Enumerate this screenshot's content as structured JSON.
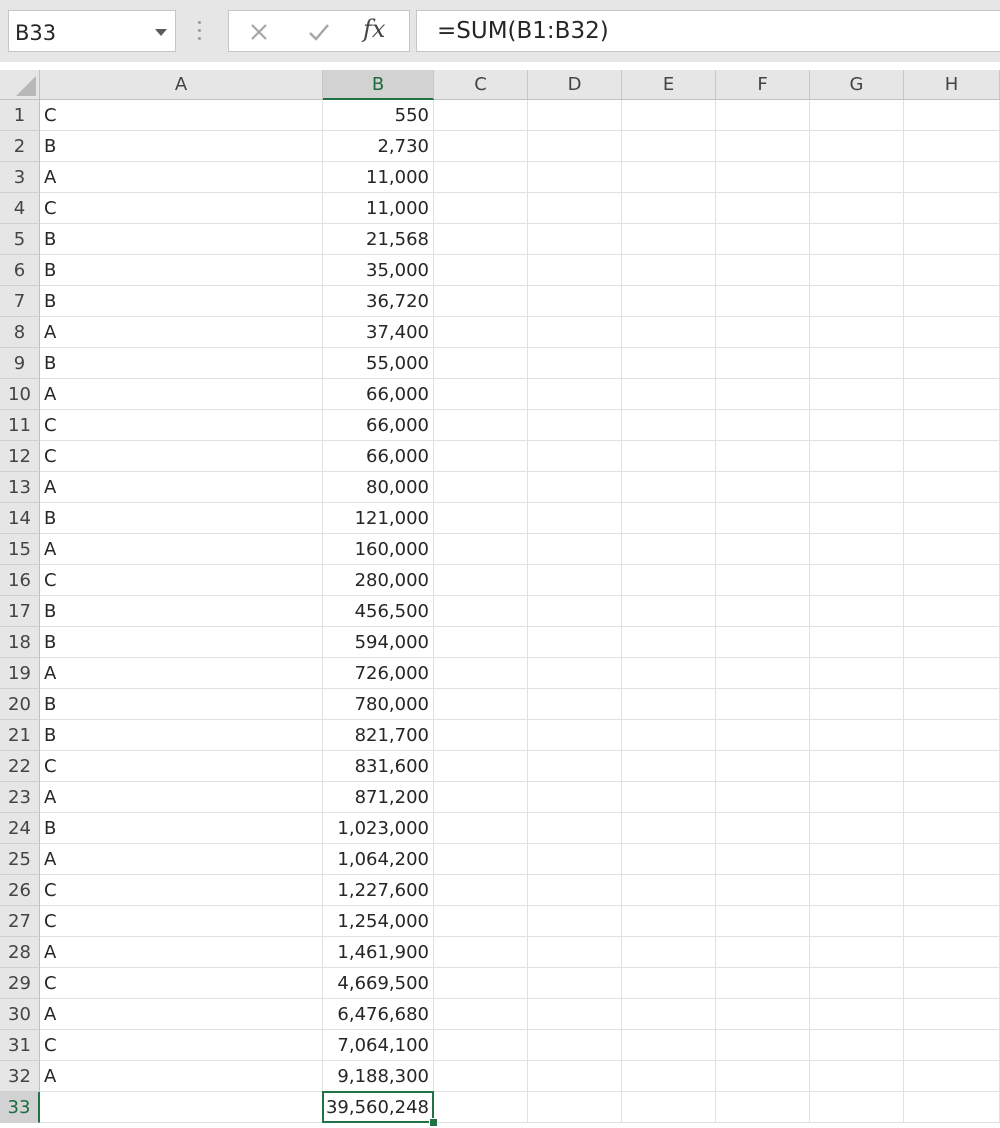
{
  "formula_bar": {
    "name_box": "B33",
    "function_label": "fx",
    "formula": "=SUM(B1:B32)"
  },
  "columns": [
    "A",
    "B",
    "C",
    "D",
    "E",
    "F",
    "G",
    "H"
  ],
  "selected_column": "B",
  "selected_row": 33,
  "active_cell": "B33",
  "rows": [
    {
      "num": 1,
      "a": "C",
      "b": "550"
    },
    {
      "num": 2,
      "a": "B",
      "b": "2,730"
    },
    {
      "num": 3,
      "a": "A",
      "b": "11,000"
    },
    {
      "num": 4,
      "a": "C",
      "b": "11,000"
    },
    {
      "num": 5,
      "a": "B",
      "b": "21,568"
    },
    {
      "num": 6,
      "a": "B",
      "b": "35,000"
    },
    {
      "num": 7,
      "a": "B",
      "b": "36,720"
    },
    {
      "num": 8,
      "a": "A",
      "b": "37,400"
    },
    {
      "num": 9,
      "a": "B",
      "b": "55,000"
    },
    {
      "num": 10,
      "a": "A",
      "b": "66,000"
    },
    {
      "num": 11,
      "a": "C",
      "b": "66,000"
    },
    {
      "num": 12,
      "a": "C",
      "b": "66,000"
    },
    {
      "num": 13,
      "a": "A",
      "b": "80,000"
    },
    {
      "num": 14,
      "a": "B",
      "b": "121,000"
    },
    {
      "num": 15,
      "a": "A",
      "b": "160,000"
    },
    {
      "num": 16,
      "a": "C",
      "b": "280,000"
    },
    {
      "num": 17,
      "a": "B",
      "b": "456,500"
    },
    {
      "num": 18,
      "a": "B",
      "b": "594,000"
    },
    {
      "num": 19,
      "a": "A",
      "b": "726,000"
    },
    {
      "num": 20,
      "a": "B",
      "b": "780,000"
    },
    {
      "num": 21,
      "a": "B",
      "b": "821,700"
    },
    {
      "num": 22,
      "a": "C",
      "b": "831,600"
    },
    {
      "num": 23,
      "a": "A",
      "b": "871,200"
    },
    {
      "num": 24,
      "a": "B",
      "b": "1,023,000"
    },
    {
      "num": 25,
      "a": "A",
      "b": "1,064,200"
    },
    {
      "num": 26,
      "a": "C",
      "b": "1,227,600"
    },
    {
      "num": 27,
      "a": "C",
      "b": "1,254,000"
    },
    {
      "num": 28,
      "a": "A",
      "b": "1,461,900"
    },
    {
      "num": 29,
      "a": "C",
      "b": "4,669,500"
    },
    {
      "num": 30,
      "a": "A",
      "b": "6,476,680"
    },
    {
      "num": 31,
      "a": "C",
      "b": "7,064,100"
    },
    {
      "num": 32,
      "a": "A",
      "b": "9,188,300"
    },
    {
      "num": 33,
      "a": "",
      "b": "39,560,248"
    }
  ],
  "colors": {
    "accent": "#217346",
    "header_bg": "#e6e6e6",
    "gridline": "#e1e1e1"
  }
}
